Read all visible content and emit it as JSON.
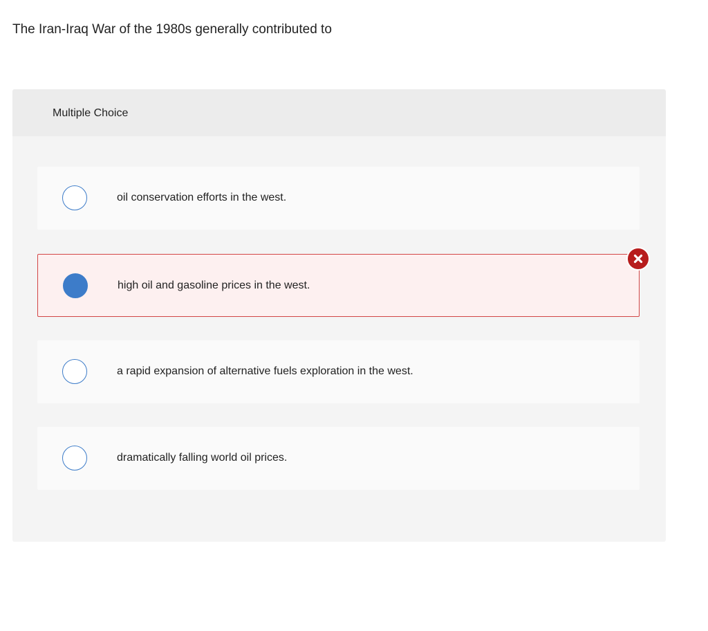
{
  "question": {
    "text": "The Iran-Iraq War of the 1980s generally contributed to"
  },
  "panel": {
    "title": "Multiple Choice"
  },
  "options": [
    {
      "label": "oil conservation efforts in the west.",
      "selected": false
    },
    {
      "label": "high oil and gasoline prices in the west.",
      "selected": true,
      "status": "incorrect"
    },
    {
      "label": "a rapid expansion of alternative fuels exploration in the west.",
      "selected": false
    },
    {
      "label": "dramatically falling world oil prices.",
      "selected": false
    }
  ],
  "colors": {
    "accent": "#3d7cc9",
    "error": "#b71c1c",
    "error_border": "#d24545",
    "error_background": "#fdf0f0"
  },
  "icons": {
    "incorrect": "close-x-icon"
  }
}
